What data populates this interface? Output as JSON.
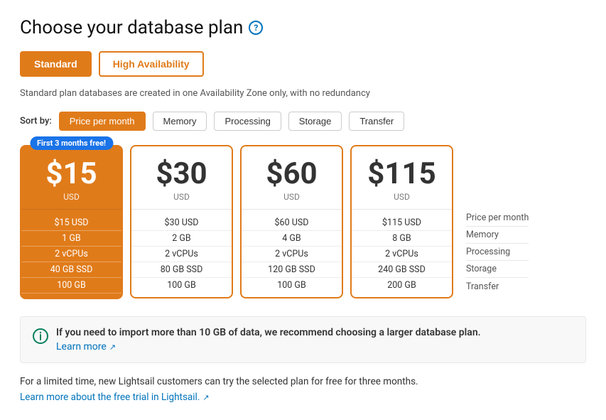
{
  "page": {
    "title": "Choose your database plan",
    "help_icon_label": "?",
    "subtitle": "Standard plan databases are created in one Availability Zone only, with no redundancy"
  },
  "tabs": [
    {
      "id": "standard",
      "label": "Standard",
      "active": true
    },
    {
      "id": "high-availability",
      "label": "High Availability",
      "active": false
    }
  ],
  "sort": {
    "label": "Sort by:",
    "options": [
      {
        "id": "price",
        "label": "Price per month",
        "active": true
      },
      {
        "id": "memory",
        "label": "Memory",
        "active": false
      },
      {
        "id": "processing",
        "label": "Processing",
        "active": false
      },
      {
        "id": "storage",
        "label": "Storage",
        "active": false
      },
      {
        "id": "transfer",
        "label": "Transfer",
        "active": false
      }
    ]
  },
  "plans": [
    {
      "id": "plan-15",
      "price": "$15",
      "currency": "USD",
      "selected": true,
      "badge": "First 3 months free!",
      "price_label": "$15 USD",
      "memory": "1 GB",
      "processing": "2 vCPUs",
      "storage": "40 GB SSD",
      "transfer": "100 GB"
    },
    {
      "id": "plan-30",
      "price": "$30",
      "currency": "USD",
      "selected": false,
      "badge": null,
      "price_label": "$30 USD",
      "memory": "2 GB",
      "processing": "2 vCPUs",
      "storage": "80 GB SSD",
      "transfer": "100 GB"
    },
    {
      "id": "plan-60",
      "price": "$60",
      "currency": "USD",
      "selected": false,
      "badge": null,
      "price_label": "$60 USD",
      "memory": "4 GB",
      "processing": "2 vCPUs",
      "storage": "120 GB SSD",
      "transfer": "100 GB"
    },
    {
      "id": "plan-115",
      "price": "$115",
      "currency": "USD",
      "selected": false,
      "badge": null,
      "price_label": "$115 USD",
      "memory": "8 GB",
      "processing": "2 vCPUs",
      "storage": "240 GB SSD",
      "transfer": "200 GB"
    }
  ],
  "column_labels": [
    "Price per month",
    "Memory",
    "Processing",
    "Storage",
    "Transfer"
  ],
  "info_box": {
    "text": "If you need to import more than 10 GB of data, we recommend choosing a larger database plan.",
    "link_text": "Learn more",
    "link_icon": "↗"
  },
  "footer": {
    "text": "For a limited time, new Lightsail customers can try the selected plan for free for three months.",
    "link_text": "Learn more about the free trial in Lightsail.",
    "link_icon": "↗"
  }
}
